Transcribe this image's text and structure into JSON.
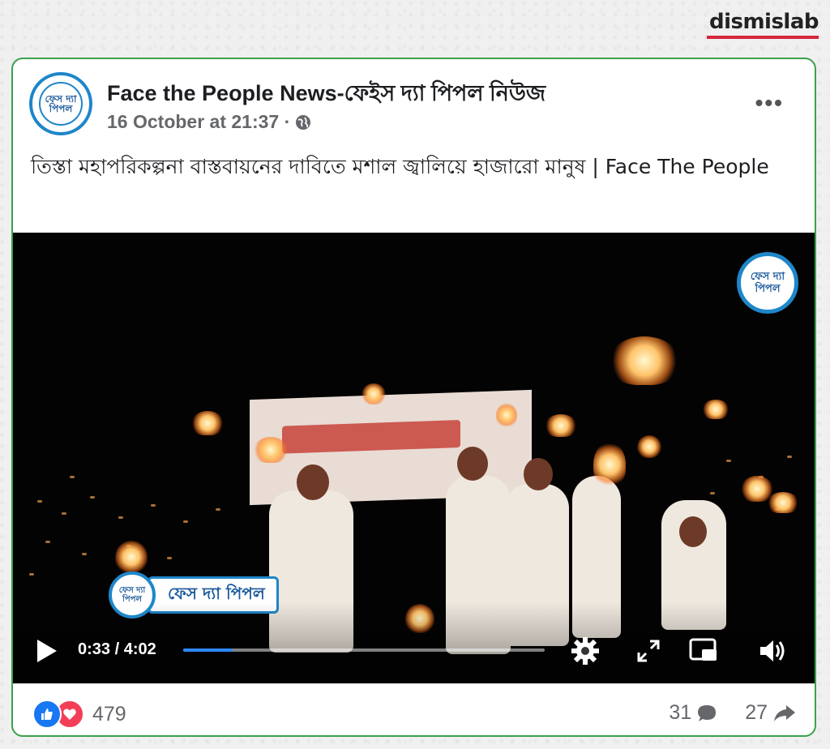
{
  "brand": {
    "name": "dismislab",
    "accent": "#d6263b"
  },
  "post": {
    "page_name": "Face the People News-ফেইস দ্যা পিপল নিউজ",
    "timestamp": "16 October at 21:37 ·",
    "audience_icon": "globe-icon",
    "more_label": "•••",
    "caption": "তিস্তা মহাপরিকল্পনা বাস্তবায়নের দাবিতে মশাল জ্বালিয়ে হাজারো মানুষ | Face The People",
    "avatar_text": "ফেস দ্যা পিপল"
  },
  "video": {
    "watermark_text": "ফেস দ্যা পিপল",
    "lower_third_text": "ফেস দ্যা পিপল",
    "lower_third_logo_text": "ফেস দ্যা পিপল",
    "current_time": "0:33",
    "duration": "4:02",
    "time_label": "0:33 / 4:02",
    "progress": 0.136,
    "icons": [
      "play-icon",
      "settings-gear-icon",
      "fullscreen-icon",
      "picture-in-picture-icon",
      "volume-icon"
    ]
  },
  "footer": {
    "reaction_count": "479",
    "reactions": [
      "like-icon",
      "love-icon"
    ],
    "comments_count": "31",
    "shares_count": "27"
  },
  "colors": {
    "card_border": "#3aa14a",
    "fb_blue": "#1877f2",
    "love_red": "#f33e58",
    "logo_blue": "#1e86c9"
  }
}
